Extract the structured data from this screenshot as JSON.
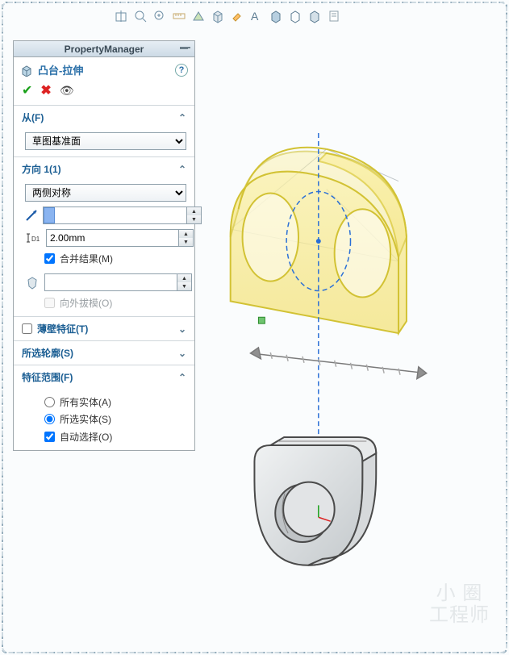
{
  "pm": {
    "title": "PropertyManager"
  },
  "feature": {
    "name": "凸台-拉伸"
  },
  "sections": {
    "from": {
      "label": "从(F)",
      "value": "草图基准面"
    },
    "dir1": {
      "label": "方向 1(1)",
      "condition": "两侧对称",
      "distance_value": "",
      "depth_value": "2.00mm",
      "merge_label": "合并结果(M)",
      "draft_on": "向外拔模(O)"
    },
    "thin": {
      "label": "薄壁特征(T)"
    },
    "contour": {
      "label": "所选轮廓(S)"
    },
    "scope": {
      "label": "特征范围(F)",
      "all": "所有实体(A)",
      "selected": "所选实体(S)",
      "auto": "自动选择(O)"
    }
  },
  "watermark": {
    "line1": "小 圈",
    "line2": "工程师"
  }
}
